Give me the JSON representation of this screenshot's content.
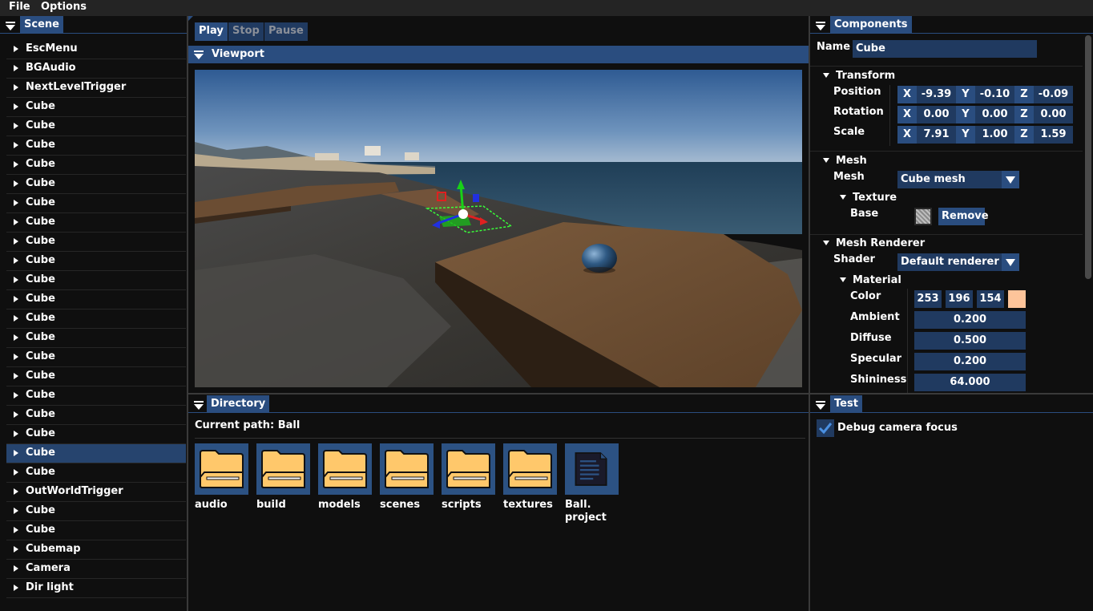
{
  "menu": {
    "file": "File",
    "options": "Options"
  },
  "scene": {
    "title": "Scene",
    "items": [
      "EscMenu",
      "BGAudio",
      "NextLevelTrigger",
      "Cube",
      "Cube",
      "Cube",
      "Cube",
      "Cube",
      "Cube",
      "Cube",
      "Cube",
      "Cube",
      "Cube",
      "Cube",
      "Cube",
      "Cube",
      "Cube",
      "Cube",
      "Cube",
      "Cube",
      "Cube",
      "Cube",
      "Cube",
      "OutWorldTrigger",
      "Cube",
      "Cube",
      "Cubemap",
      "Camera",
      "Dir light"
    ],
    "selected_index": 21
  },
  "toolbar": {
    "play": "Play",
    "stop": "Stop",
    "pause": "Pause"
  },
  "viewport": {
    "title": "Viewport"
  },
  "directory": {
    "title": "Directory",
    "current_path": "Current path: Ball",
    "items": [
      "audio",
      "build",
      "models",
      "scenes",
      "scripts",
      "textures"
    ],
    "file_line1": "Ball.",
    "file_line2": "project"
  },
  "components": {
    "title": "Components",
    "name_label": "Name",
    "name_value": "Cube",
    "transform": {
      "title": "Transform",
      "position_label": "Position",
      "rotation_label": "Rotation",
      "scale_label": "Scale",
      "x": "X",
      "y": "Y",
      "z": "Z",
      "position": [
        "-9.39",
        "-0.10",
        "-0.09"
      ],
      "rotation": [
        "0.00",
        "0.00",
        "0.00"
      ],
      "scale": [
        "7.91",
        "1.00",
        "1.59"
      ]
    },
    "mesh": {
      "title": "Mesh",
      "mesh_label": "Mesh",
      "mesh_value": "Cube mesh",
      "texture_title": "Texture",
      "base_label": "Base",
      "remove": "Remove"
    },
    "renderer": {
      "title": "Mesh Renderer",
      "shader_label": "Shader",
      "shader_value": "Default renderer",
      "material_title": "Material",
      "color_label": "Color",
      "color": [
        "253",
        "196",
        "154"
      ],
      "color_swatch": "#fdc49a",
      "ambient_label": "Ambient",
      "ambient": "0.200",
      "diffuse_label": "Diffuse",
      "diffuse": "0.500",
      "specular_label": "Specular",
      "specular": "0.200",
      "shininess_label": "Shininess",
      "shininess": "64.000"
    }
  },
  "test": {
    "title": "Test",
    "debug_label": "Debug camera focus",
    "debug_checked": true
  },
  "colors": {
    "accent": "#2a4d7f",
    "selection": "#26446e",
    "folder": "#ffc86b"
  }
}
